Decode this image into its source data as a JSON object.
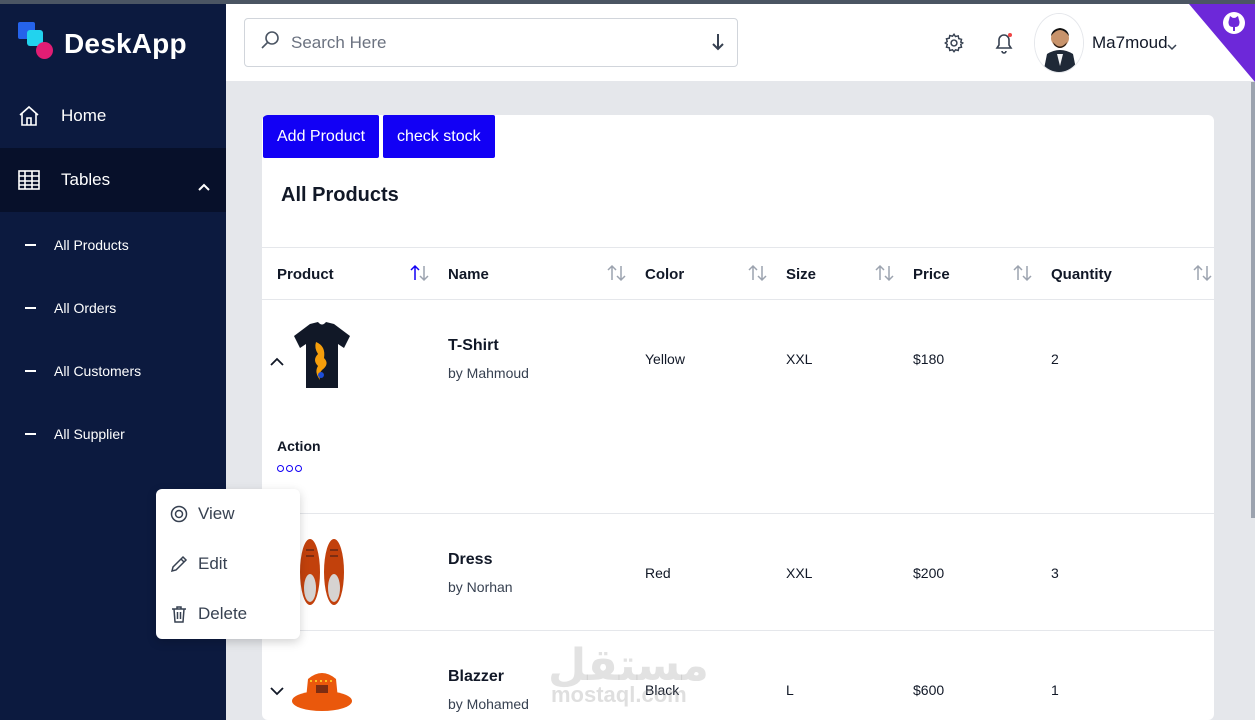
{
  "app": {
    "name": "DeskApp"
  },
  "sidebar": {
    "home_label": "Home",
    "tables_label": "Tables",
    "sub_items": [
      {
        "label": "All Products"
      },
      {
        "label": "All Orders"
      },
      {
        "label": "All Customers"
      },
      {
        "label": "All Supplier"
      }
    ]
  },
  "header": {
    "search_placeholder": "Search Here",
    "user_name": "Ma7moud"
  },
  "toolbar": {
    "add_label": "Add Product",
    "stock_label": "check stock"
  },
  "main": {
    "title": "All Products",
    "columns": [
      "Product",
      "Name",
      "Color",
      "Size",
      "Price",
      "Quantity"
    ],
    "action_label": "Action",
    "rows": [
      {
        "name": "T-Shirt",
        "by": "by Mahmoud",
        "color": "Yellow",
        "size": "XXL",
        "price": "$180",
        "quantity": "2",
        "expanded": true
      },
      {
        "name": "Dress",
        "by": "by Norhan",
        "color": "Red",
        "size": "XXL",
        "price": "$200",
        "quantity": "3",
        "expanded": false
      },
      {
        "name": "Blazzer",
        "by": "by Mohamed",
        "color": "Black",
        "size": "L",
        "price": "$600",
        "quantity": "1",
        "expanded": false
      }
    ]
  },
  "menu": {
    "view_label": "View",
    "edit_label": "Edit",
    "delete_label": "Delete"
  },
  "watermark": {
    "text": "مستقل",
    "sub": "mostaql.com"
  },
  "colors": {
    "sidebar": "#0c1a3f",
    "accent": "#1200f5",
    "sidebar_active": "#07102a"
  },
  "icons": [
    "home-icon",
    "table-icon",
    "search-icon",
    "arrow-down-icon",
    "gear-icon",
    "bell-icon",
    "github-icon",
    "eye-icon",
    "pencil-icon",
    "trash-icon",
    "sort-icon"
  ]
}
